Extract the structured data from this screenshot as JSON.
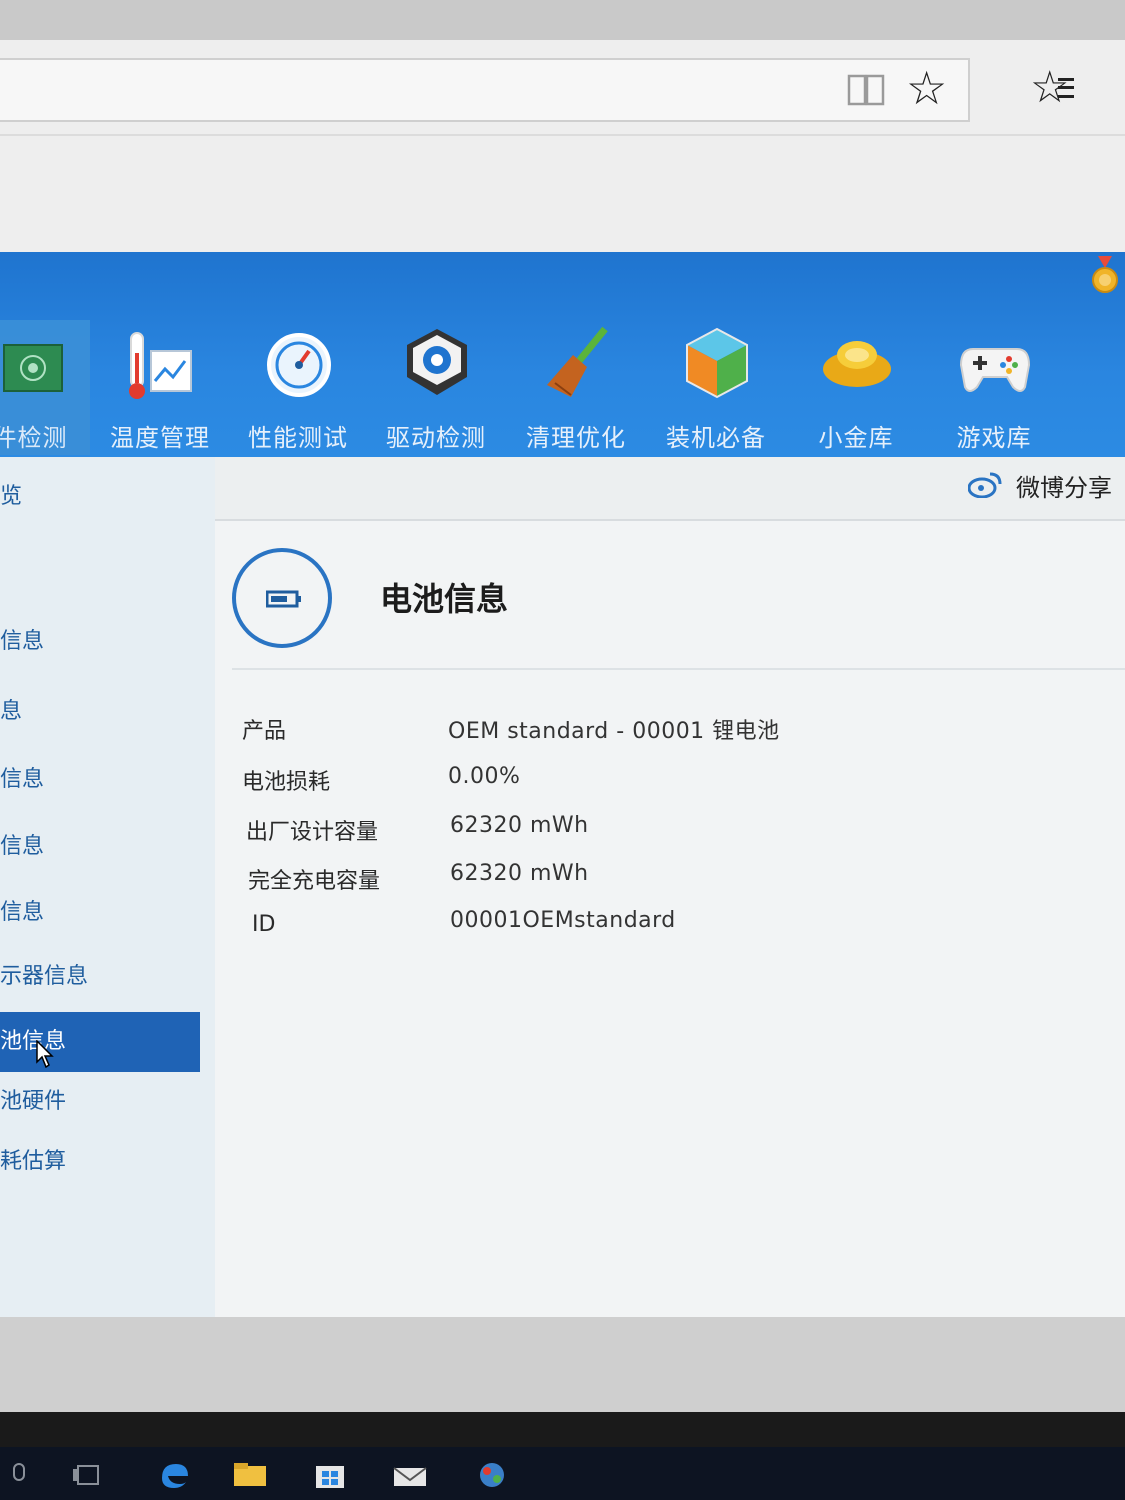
{
  "nav": {
    "items": [
      {
        "label": "件检测",
        "icon": "hardware-board-icon",
        "active": true
      },
      {
        "label": "温度管理",
        "icon": "thermometer-icon"
      },
      {
        "label": "性能测试",
        "icon": "gauge-icon"
      },
      {
        "label": "驱动检测",
        "icon": "gear-box-icon"
      },
      {
        "label": "清理优化",
        "icon": "broom-icon"
      },
      {
        "label": "装机必备",
        "icon": "cube-icon"
      },
      {
        "label": "小金库",
        "icon": "gold-ingot-icon"
      },
      {
        "label": "游戏库",
        "icon": "gamepad-icon"
      }
    ]
  },
  "share": {
    "label": "微博分享"
  },
  "sidebar": {
    "items": [
      {
        "label": "览"
      },
      {
        "label": "信息"
      },
      {
        "label": "息"
      },
      {
        "label": "信息"
      },
      {
        "label": "信息"
      },
      {
        "label": "信息"
      },
      {
        "label": "示器信息"
      },
      {
        "label": "池信息",
        "active": true
      },
      {
        "label": "池硬件"
      },
      {
        "label": "耗估算"
      }
    ]
  },
  "battery": {
    "title": "电池信息",
    "rows": [
      {
        "label": "产品",
        "value": "OEM standard - 00001 锂电池"
      },
      {
        "label": "电池损耗",
        "value": "0.00%"
      },
      {
        "label": "出厂设计容量",
        "value": "62320 mWh"
      },
      {
        "label": "完全充电容量",
        "value": "62320 mWh"
      },
      {
        "label": "ID",
        "value": "00001OEMstandard"
      }
    ]
  },
  "colors": {
    "header_blue": "#2a86e0",
    "sidebar_active": "#1f63b5",
    "circle_blue": "#2a74c3"
  }
}
